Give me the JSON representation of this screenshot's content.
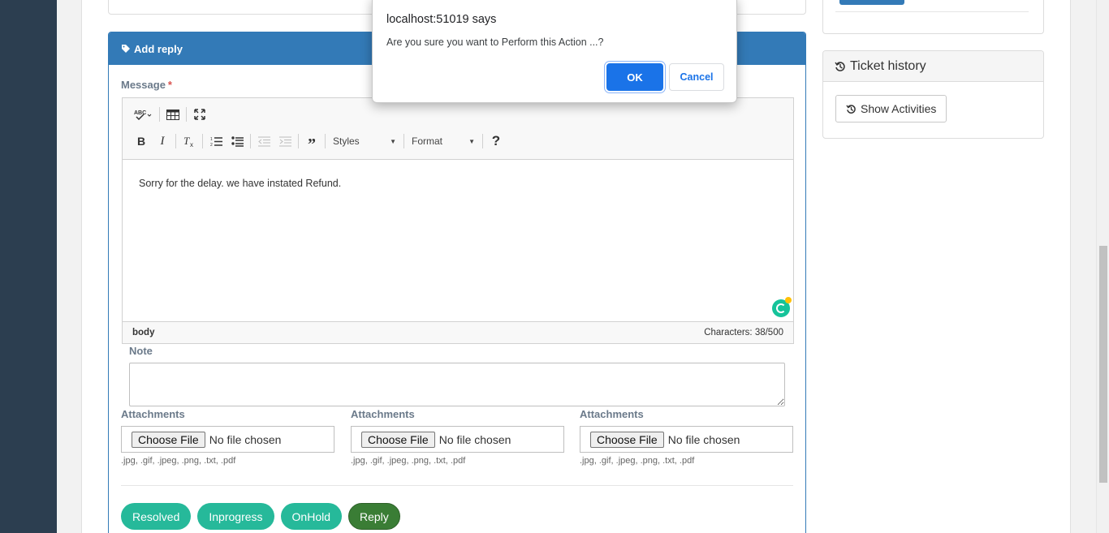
{
  "reply_panel": {
    "title": "Add reply",
    "message_label": "Message",
    "required_mark": "*",
    "editor": {
      "toolbar": {
        "row1": [
          "spellcheck-icon",
          "table-icon",
          "maximize-icon"
        ],
        "row2": [
          "bold-icon",
          "italic-icon",
          "remove-format-icon",
          "numbered-list-icon",
          "bulleted-list-icon",
          "outdent-icon",
          "indent-icon",
          "blockquote-icon"
        ],
        "styles_label": "Styles",
        "format_label": "Format",
        "help_label": "?"
      },
      "content": "Sorry for the delay. we have instated Refund.",
      "path": "body",
      "char_count": "Characters: 38/500"
    },
    "note_label": "Note",
    "note_value": "",
    "attachments": [
      {
        "label": "Attachments",
        "button": "Choose File",
        "status": "No file chosen",
        "hint": ".jpg, .gif, .jpeg, .png, .txt, .pdf"
      },
      {
        "label": "Attachments",
        "button": "Choose File",
        "status": "No file chosen",
        "hint": ".jpg, .gif, .jpeg, .png, .txt, .pdf"
      },
      {
        "label": "Attachments",
        "button": "Choose File",
        "status": "No file chosen",
        "hint": ".jpg, .gif, .jpeg, .png, .txt, .pdf"
      }
    ],
    "actions": [
      {
        "label": "Resolved",
        "color": "#26b99a"
      },
      {
        "label": "Inprogress",
        "color": "#26b99a"
      },
      {
        "label": "OnHold",
        "color": "#26b99a"
      },
      {
        "label": "Reply",
        "color": "#3a7d35"
      }
    ]
  },
  "ticket_history": {
    "title": "Ticket history",
    "button": "Show Activities"
  },
  "dialog": {
    "title": "localhost:51019 says",
    "message": "Are you sure you want to Perform this Action ...?",
    "ok": "OK",
    "cancel": "Cancel"
  },
  "colors": {
    "primary": "#337ab7",
    "sidebar": "#2c3e50",
    "success": "#26b99a",
    "reply": "#3a7d35",
    "dialog_accent": "#1a73e8"
  }
}
